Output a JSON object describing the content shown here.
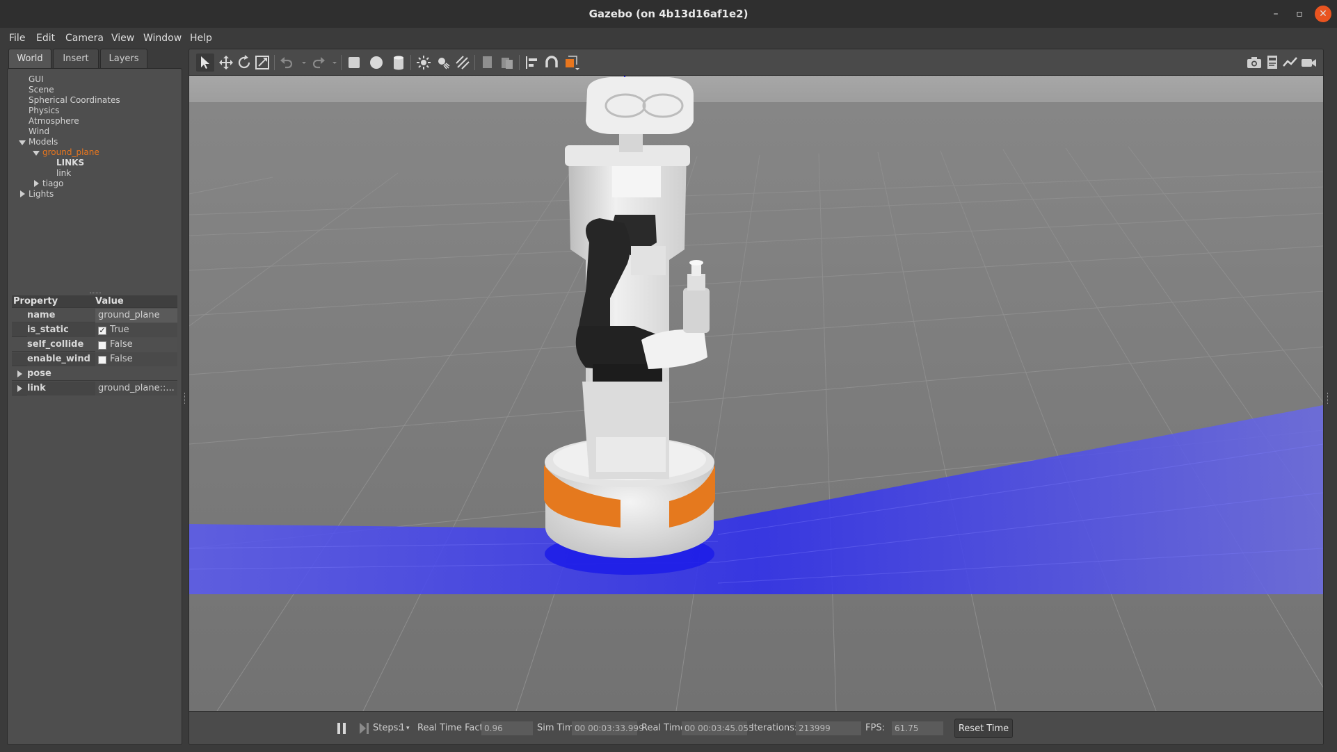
{
  "window": {
    "title": "Gazebo (on 4b13d16af1e2)",
    "min_glyph": "–",
    "max_glyph": "▫",
    "close_glyph": "✕"
  },
  "menu": [
    "File",
    "Edit",
    "Camera",
    "View",
    "Window",
    "Help"
  ],
  "tabs": [
    "World",
    "Insert",
    "Layers"
  ],
  "tree": {
    "items": [
      "GUI",
      "Scene",
      "Spherical Coordinates",
      "Physics",
      "Atmosphere",
      "Wind"
    ],
    "models_label": "Models",
    "ground_plane": "ground_plane",
    "links_label": "LINKS",
    "link_label": "link",
    "tiago": "tiago",
    "lights": "Lights"
  },
  "properties": {
    "header_property": "Property",
    "header_value": "Value",
    "rows": [
      {
        "name": "name",
        "value": "ground_plane"
      },
      {
        "name": "is_static",
        "value": "True",
        "checked": true
      },
      {
        "name": "self_collide",
        "value": "False",
        "checked": false
      },
      {
        "name": "enable_wind",
        "value": "False",
        "checked": false
      },
      {
        "name": "pose",
        "value": ""
      },
      {
        "name": "link",
        "value": "ground_plane::..."
      }
    ]
  },
  "toolbar_icons": [
    "select-arrow-icon",
    "translate-icon",
    "rotate-icon",
    "scale-icon",
    "undo-icon",
    "redo-icon",
    "box-shape-icon",
    "sphere-shape-icon",
    "cylinder-shape-icon",
    "point-light-icon",
    "spot-light-icon",
    "directional-light-icon",
    "copy-icon",
    "paste-icon",
    "align-icon",
    "snap-icon",
    "view-angle-icon",
    "screenshot-icon",
    "log-icon",
    "plot-icon",
    "video-record-icon"
  ],
  "status": {
    "steps_label": "Steps:",
    "steps_value": "1",
    "rtf_label": "Real Time Factor:",
    "rtf_value": "0.96",
    "sim_label": "Sim Time:",
    "sim_value": "00 00:03:33.999",
    "real_label": "Real Time:",
    "real_value": "00 00:03:45.055",
    "iter_label": "Iterations:",
    "iter_value": "213999",
    "fps_label": "FPS:",
    "fps_value": "61.75",
    "reset_label": "Reset Time"
  },
  "colors": {
    "accent_orange": "#e8761e",
    "laser_blue": "#3a3ae8",
    "close_button": "#e95420"
  }
}
